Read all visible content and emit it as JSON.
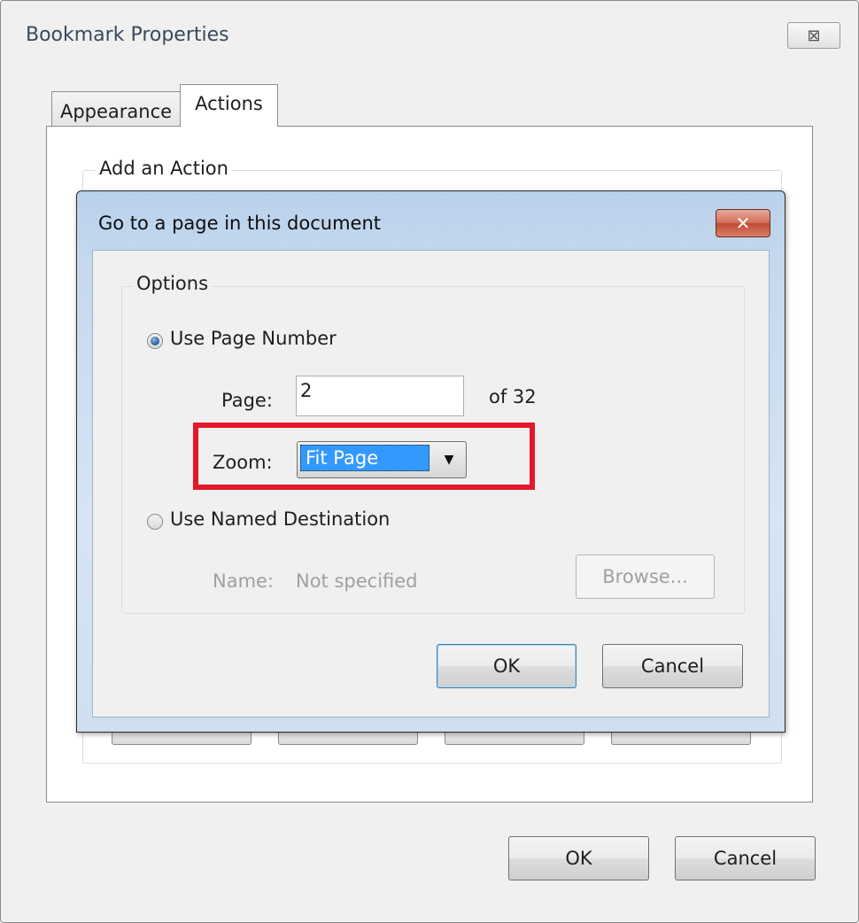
{
  "outer_window": {
    "title": "Bookmark Properties",
    "close_glyph": "⊠",
    "tabs": [
      {
        "label": "Appearance",
        "selected": false
      },
      {
        "label": "Actions",
        "selected": true
      }
    ],
    "group_label": "Add an Action",
    "ok_label": "OK",
    "cancel_label": "Cancel"
  },
  "dialog": {
    "title": "Go to a page in this document",
    "close_glyph": "✕",
    "options_label": "Options",
    "use_page_number": {
      "label": "Use Page Number",
      "checked": true
    },
    "page_label": "Page:",
    "page_value": "2",
    "of_pages": "of 32",
    "zoom_label": "Zoom:",
    "zoom_value": "Fit Page",
    "use_named_destination": {
      "label": "Use Named Destination",
      "checked": false
    },
    "name_label": "Name:",
    "name_value": "Not specified",
    "browse_label": "Browse...",
    "ok_label": "OK",
    "cancel_label": "Cancel"
  },
  "colors": {
    "highlight": "#e3192b",
    "selection": "#3399ff",
    "title_gradient": "#b9d1ea",
    "close_red": "#c04a31"
  },
  "icons": {
    "outer_close": "close-icon",
    "dialog_close": "close-icon",
    "dropdown": "chevron-down-icon"
  }
}
